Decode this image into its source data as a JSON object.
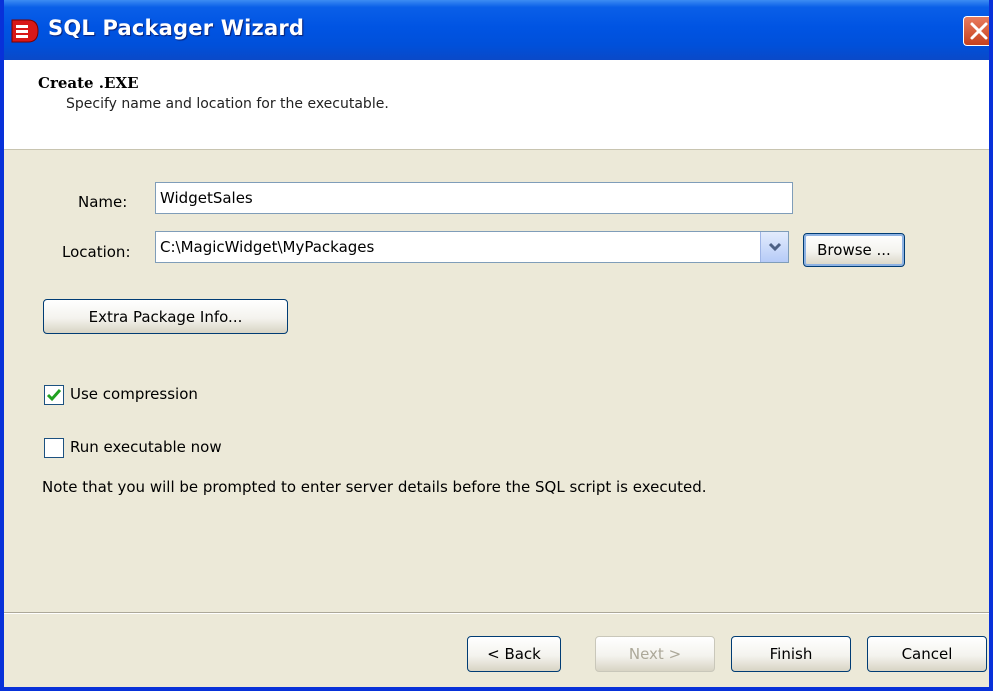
{
  "window": {
    "title": "SQL Packager Wizard",
    "icon": "sql-packager-icon",
    "close_icon": "close-icon"
  },
  "header": {
    "title": "Create .EXE",
    "subtitle": "Specify name and location for the executable."
  },
  "form": {
    "name_label": "Name:",
    "name_value": "WidgetSales",
    "location_label": "Location:",
    "location_value": "C:\\MagicWidget\\MyPackages",
    "browse_label": "Browse ...",
    "extra_info_label": "Extra Package Info..."
  },
  "options": {
    "use_compression_label": "Use compression",
    "use_compression_checked": true,
    "run_now_label": "Run executable now",
    "run_now_checked": false,
    "note": "Note that you will be prompted to enter server details before the SQL script is executed."
  },
  "footer": {
    "back_label": "< Back",
    "next_label": "Next >",
    "finish_label": "Finish",
    "cancel_label": "Cancel"
  },
  "colors": {
    "title_bar": "#0054E3",
    "dialog_bg": "#ECE9D8",
    "check_mark": "#21A121"
  }
}
